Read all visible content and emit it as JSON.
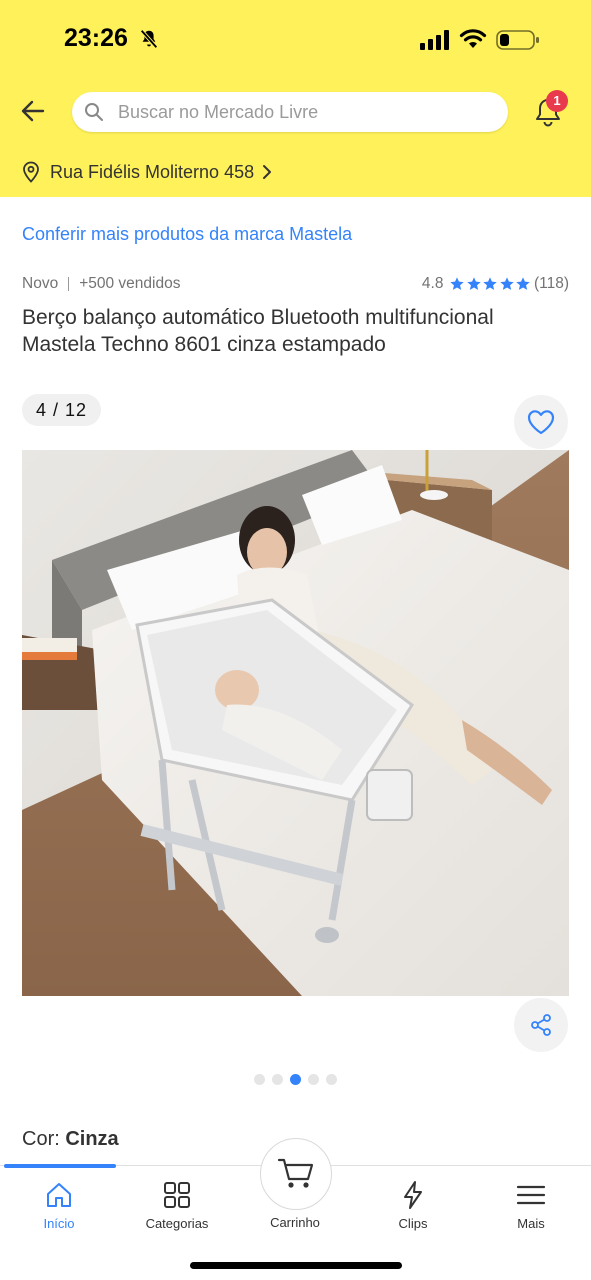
{
  "status_bar": {
    "time": "23:26",
    "icons": [
      "bell-slash-icon",
      "cellular-signal-icon",
      "wifi-icon",
      "battery-low-icon"
    ]
  },
  "header": {
    "search_placeholder": "Buscar no Mercado Livre",
    "notification_count": "1",
    "address": "Rua Fidélis Moliterno 458"
  },
  "product": {
    "brand_link": "Conferir mais produtos da marca Mastela",
    "condition": "Novo",
    "sold": "+500 vendidos",
    "rating": "4.8",
    "stars": 5,
    "review_count": "(118)",
    "title": "Berço balanço automático Bluetooth multifuncional Mastela Techno 8601 cinza estampado",
    "image_counter": "4 / 12",
    "image_index": 4,
    "image_total": 12,
    "carousel_dots": 5,
    "carousel_active_dot": 3,
    "color_label": "Cor: ",
    "color_value": "Cinza"
  },
  "nav": {
    "items": [
      {
        "label": "Início",
        "icon": "home-icon",
        "active": true
      },
      {
        "label": "Categorias",
        "icon": "grid-icon",
        "active": false
      },
      {
        "label": "Carrinho",
        "icon": "cart-icon",
        "active": false
      },
      {
        "label": "Clips",
        "icon": "lightning-icon",
        "active": false
      },
      {
        "label": "Mais",
        "icon": "menu-icon",
        "active": false
      }
    ]
  },
  "colors": {
    "brand_yellow": "#fff159",
    "accent_blue": "#3483fa",
    "badge_red": "#e8394d"
  }
}
